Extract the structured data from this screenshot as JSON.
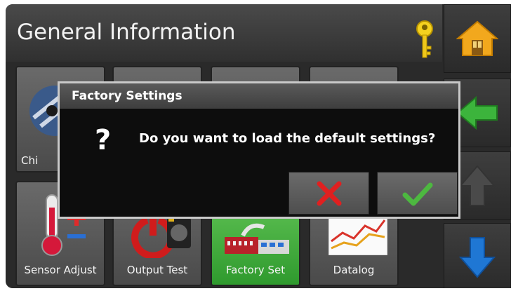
{
  "header": {
    "title": "General Information"
  },
  "nav": {
    "home_icon": "home-icon",
    "back_icon": "arrow-left-icon",
    "up_icon": "arrow-up-icon",
    "down_icon": "arrow-down-icon"
  },
  "tiles": [
    {
      "label": "Chi",
      "icon": "chiller-icon"
    },
    {
      "label": "",
      "icon": ""
    },
    {
      "label": "",
      "icon": ""
    },
    {
      "label": "",
      "icon": ""
    },
    {
      "label": "Sensor Adjust",
      "icon": "thermometer-icon"
    },
    {
      "label": "Output Test",
      "icon": "power-pump-icon"
    },
    {
      "label": "Factory Set",
      "icon": "factory-icon"
    },
    {
      "label": "Datalog",
      "icon": "datalog-chart-icon"
    }
  ],
  "dialog": {
    "title": "Factory Settings",
    "question_mark": "?",
    "message": "Do you want to load the default settings?",
    "cancel_icon": "x-icon",
    "confirm_icon": "checkmark-icon"
  },
  "colors": {
    "selected_tile": "#3aa93a",
    "home": "#f2a81d",
    "green_arrow": "#3cb43c",
    "blue_arrow": "#1f77d4",
    "cancel_red": "#e02020",
    "confirm_green": "#4db840"
  }
}
